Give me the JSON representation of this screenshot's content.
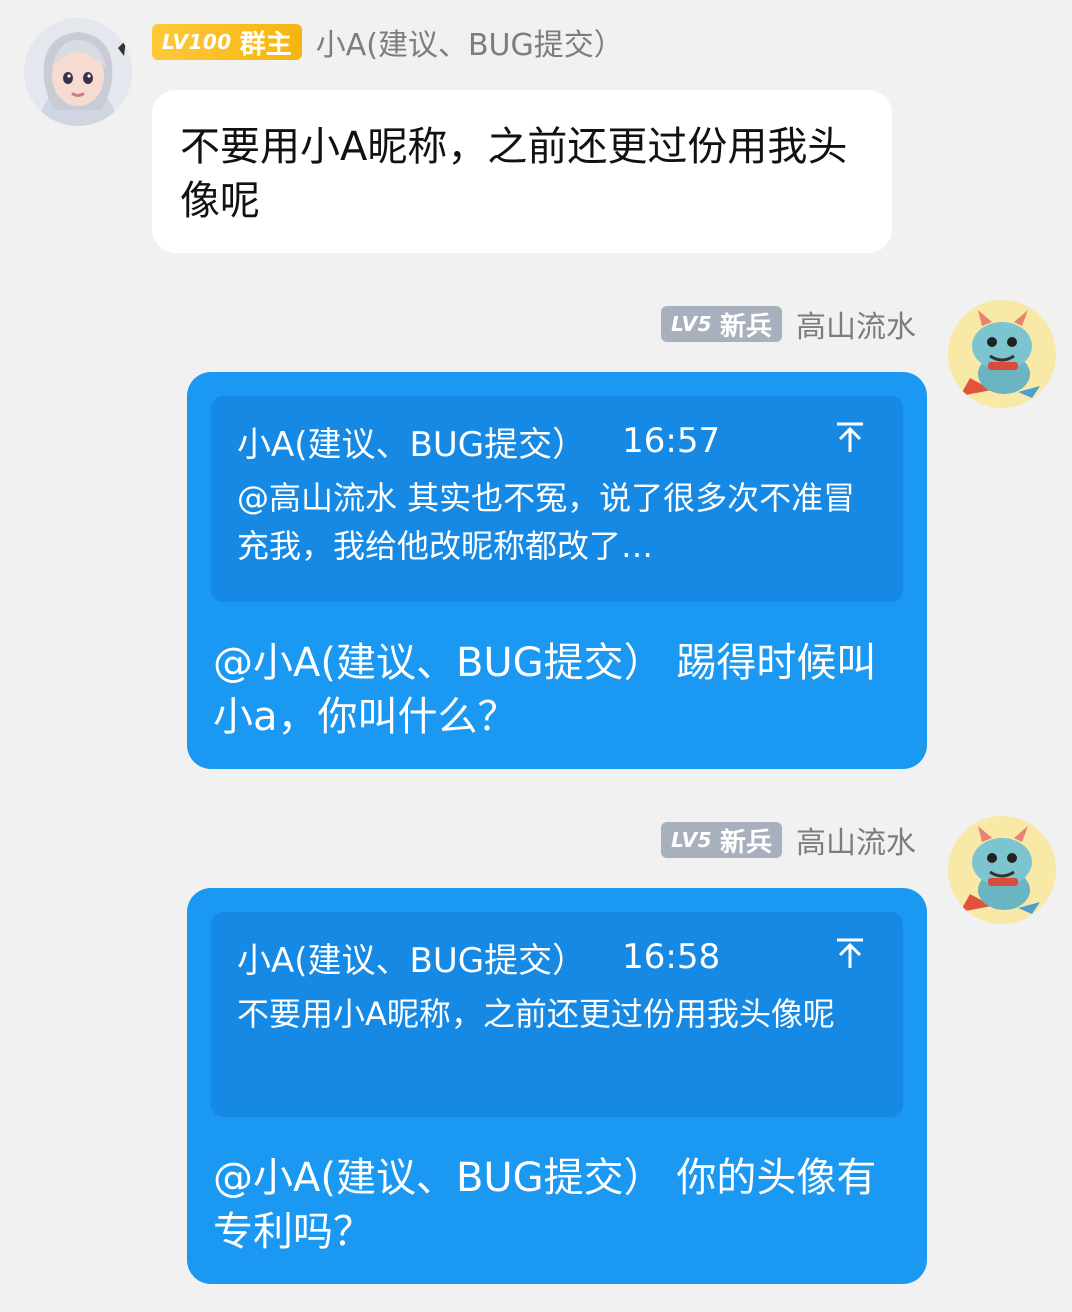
{
  "messages": [
    {
      "level_label": "LV100",
      "role": "群主",
      "nickname": "小A(建议、BUG提交）",
      "text": "不要用小A昵称，之前还更过份用我头像呢"
    },
    {
      "level_label": "LV5",
      "role": "新兵",
      "nickname": "高山流水",
      "quote_author": "小A(建议、BUG提交）",
      "quote_time": "16:57",
      "quote_text": "@高山流水 其实也不冤，说了很多次不准冒充我，我给他改昵称都改了…",
      "text": "@小A(建议、BUG提交） 踢得时候叫小a，你叫什么？"
    },
    {
      "level_label": "LV5",
      "role": "新兵",
      "nickname": "高山流水",
      "quote_author": "小A(建议、BUG提交）",
      "quote_time": "16:58",
      "quote_text": "不要用小A昵称，之前还更过份用我头像呢",
      "text": "@小A(建议、BUG提交） 你的头像有专利吗？"
    }
  ],
  "icons": {
    "quote_jump": "arrow-up-icon",
    "avatar_admin": "avatar-girl",
    "avatar_user": "avatar-dragon"
  },
  "colors": {
    "background": "#f1f1f1",
    "bubble_self": "#1a98f2",
    "quote_box": "#1589e4",
    "badge_owner": "#f5b50f",
    "badge_member": "#a9b0bd"
  }
}
